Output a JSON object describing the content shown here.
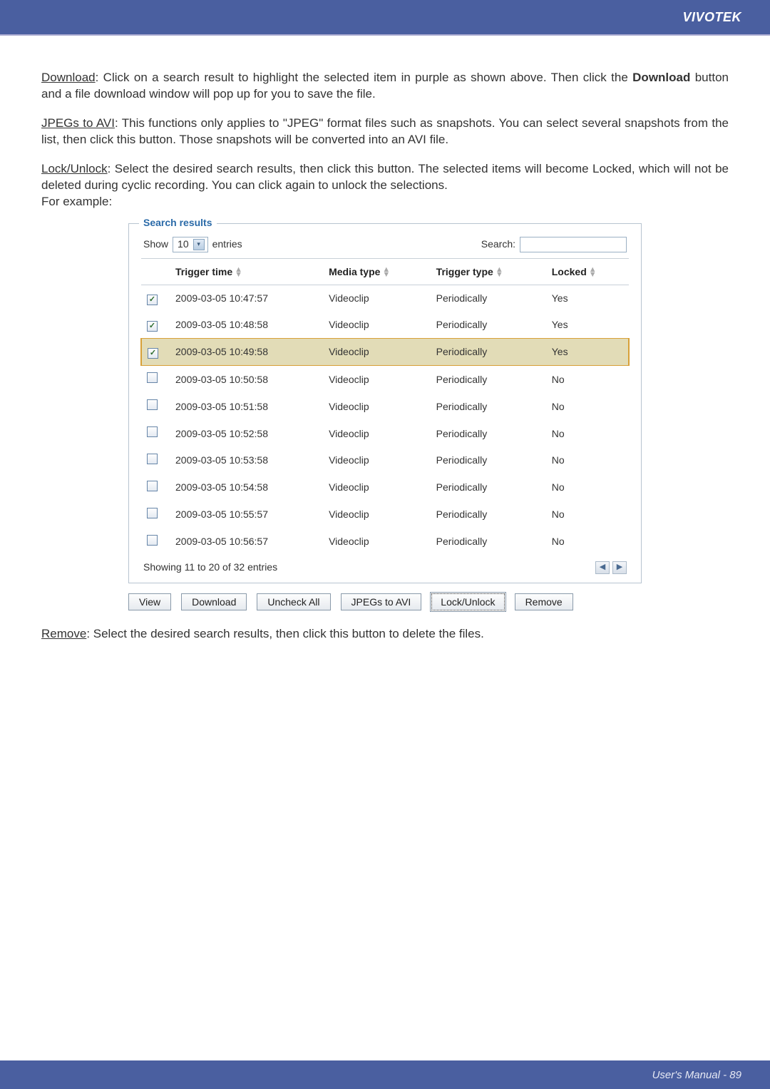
{
  "brand": "VIVOTEK",
  "footer": "User's Manual - 89",
  "body": {
    "p1_lead": "Download",
    "p1_rest": ": Click on a search result to highlight the selected item in purple as shown above. Then click the ",
    "p1_bold": "Download",
    "p1_tail": " button and a file download window will pop up for you to save the file.",
    "p2_lead": "JPEGs to AVI",
    "p2_rest": ": This functions only applies to \"JPEG\" format files such as snapshots. You can select several snapshots from the list, then click this button. Those snapshots will be converted into an AVI file.",
    "p3_lead": "Lock/Unlock",
    "p3_rest": ": Select the desired search results, then click this button. The selected items will become Locked, which will not be deleted during cyclic recording. You can click again to unlock the selections.",
    "p3_tail": "For example:",
    "p4_lead": "Remove",
    "p4_rest": ": Select the desired search results, then click this button to delete the files."
  },
  "panel": {
    "title": "Search results",
    "show_label": "Show",
    "show_value": "10",
    "entries_label": "entries",
    "search_label": "Search:",
    "search_value": "",
    "headers": {
      "trigger_time": "Trigger time",
      "media_type": "Media type",
      "trigger_type": "Trigger type",
      "locked": "Locked"
    },
    "rows": [
      {
        "checked": true,
        "selected": false,
        "time": "2009-03-05 10:47:57",
        "media": "Videoclip",
        "type": "Periodically",
        "locked": "Yes"
      },
      {
        "checked": true,
        "selected": false,
        "time": "2009-03-05 10:48:58",
        "media": "Videoclip",
        "type": "Periodically",
        "locked": "Yes"
      },
      {
        "checked": true,
        "selected": true,
        "time": "2009-03-05 10:49:58",
        "media": "Videoclip",
        "type": "Periodically",
        "locked": "Yes"
      },
      {
        "checked": false,
        "selected": false,
        "time": "2009-03-05 10:50:58",
        "media": "Videoclip",
        "type": "Periodically",
        "locked": "No"
      },
      {
        "checked": false,
        "selected": false,
        "time": "2009-03-05 10:51:58",
        "media": "Videoclip",
        "type": "Periodically",
        "locked": "No"
      },
      {
        "checked": false,
        "selected": false,
        "time": "2009-03-05 10:52:58",
        "media": "Videoclip",
        "type": "Periodically",
        "locked": "No"
      },
      {
        "checked": false,
        "selected": false,
        "time": "2009-03-05 10:53:58",
        "media": "Videoclip",
        "type": "Periodically",
        "locked": "No"
      },
      {
        "checked": false,
        "selected": false,
        "time": "2009-03-05 10:54:58",
        "media": "Videoclip",
        "type": "Periodically",
        "locked": "No"
      },
      {
        "checked": false,
        "selected": false,
        "time": "2009-03-05 10:55:57",
        "media": "Videoclip",
        "type": "Periodically",
        "locked": "No"
      },
      {
        "checked": false,
        "selected": false,
        "time": "2009-03-05 10:56:57",
        "media": "Videoclip",
        "type": "Periodically",
        "locked": "No"
      }
    ],
    "showing_text": "Showing 11 to 20 of 32 entries",
    "buttons": {
      "view": "View",
      "download": "Download",
      "uncheck_all": "Uncheck All",
      "jpegs_to_avi": "JPEGs to AVI",
      "lock_unlock": "Lock/Unlock",
      "remove": "Remove"
    }
  }
}
